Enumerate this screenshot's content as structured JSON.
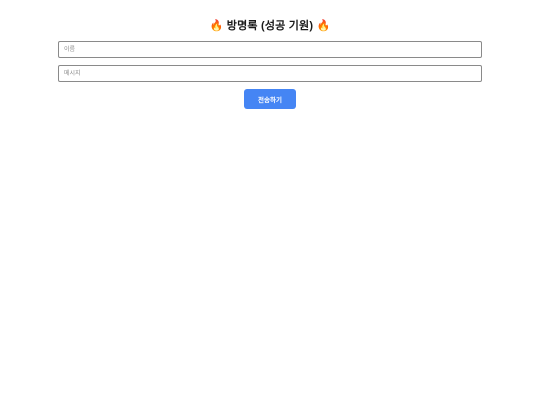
{
  "guestbook": {
    "title_prefix_icon": "fire-icon",
    "title_prefix": "🔥",
    "title": "방명록 (성공 기원)",
    "title_suffix": "🔥",
    "title_suffix_icon": "fire-icon",
    "name_input": {
      "placeholder": "이름",
      "value": ""
    },
    "message_input": {
      "placeholder": "메시지",
      "value": ""
    },
    "submit_label": "전송하기"
  },
  "colors": {
    "accent": "#4585f4",
    "background": "#ffffff",
    "input_border": "#8a8a8a"
  }
}
